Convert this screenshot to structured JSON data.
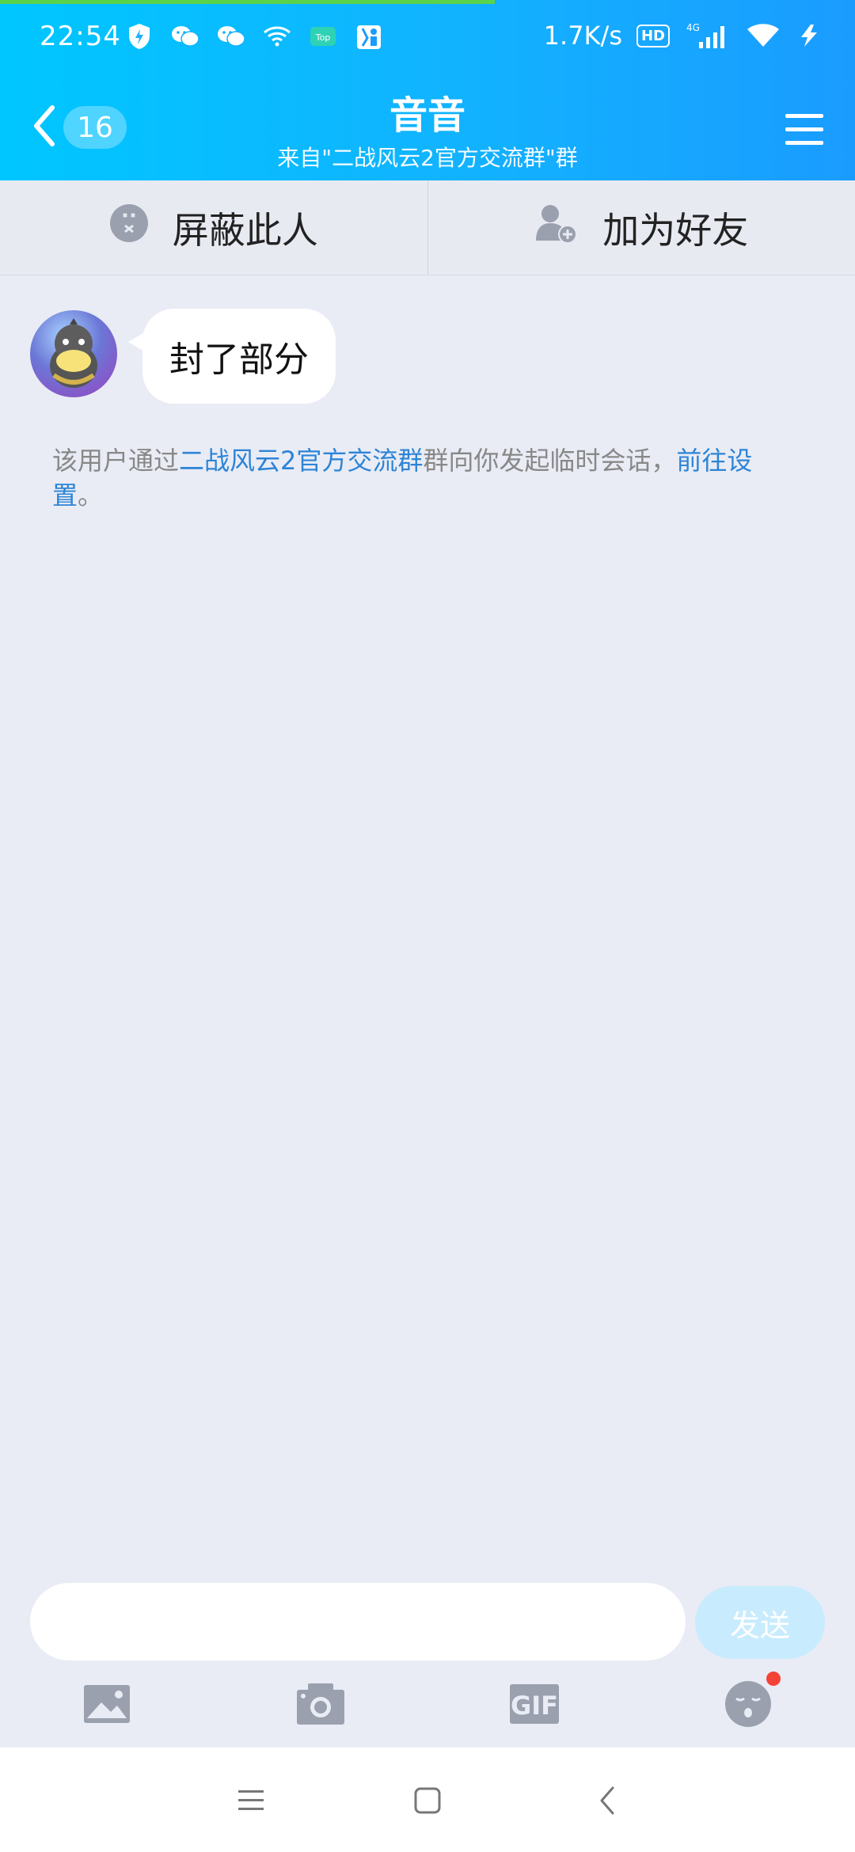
{
  "status_bar": {
    "time": "22:54",
    "network_speed": "1.7K/s",
    "hd_label": "HD",
    "network_type": "4G",
    "icons_left": [
      "shield-icon",
      "wechat-icon",
      "wechat-icon",
      "wifi-icon",
      "top-app-icon",
      "notification-app-icon"
    ],
    "icons_right": [
      "hd-icon",
      "signal-icon",
      "wifi-icon",
      "charging-icon"
    ]
  },
  "header": {
    "unread_count": "16",
    "title": "音音",
    "subtitle": "来自\"二战风云2官方交流群\"群"
  },
  "actions": {
    "block_label": "屏蔽此人",
    "add_friend_label": "加为好友"
  },
  "chat": {
    "messages": [
      {
        "text": "封了部分"
      }
    ],
    "system_note": {
      "prefix": "该用户通过",
      "group_link": "二战风云2官方交流群",
      "middle": "群向你发起临时会话，",
      "settings_link": "前往设置",
      "suffix": "。"
    }
  },
  "composer": {
    "input_value": "",
    "send_label": "发送"
  },
  "colors": {
    "header_start": "#00c6ff",
    "header_end": "#1a9cff",
    "link": "#2d84d6",
    "send_disabled": "#c8ecfd"
  }
}
